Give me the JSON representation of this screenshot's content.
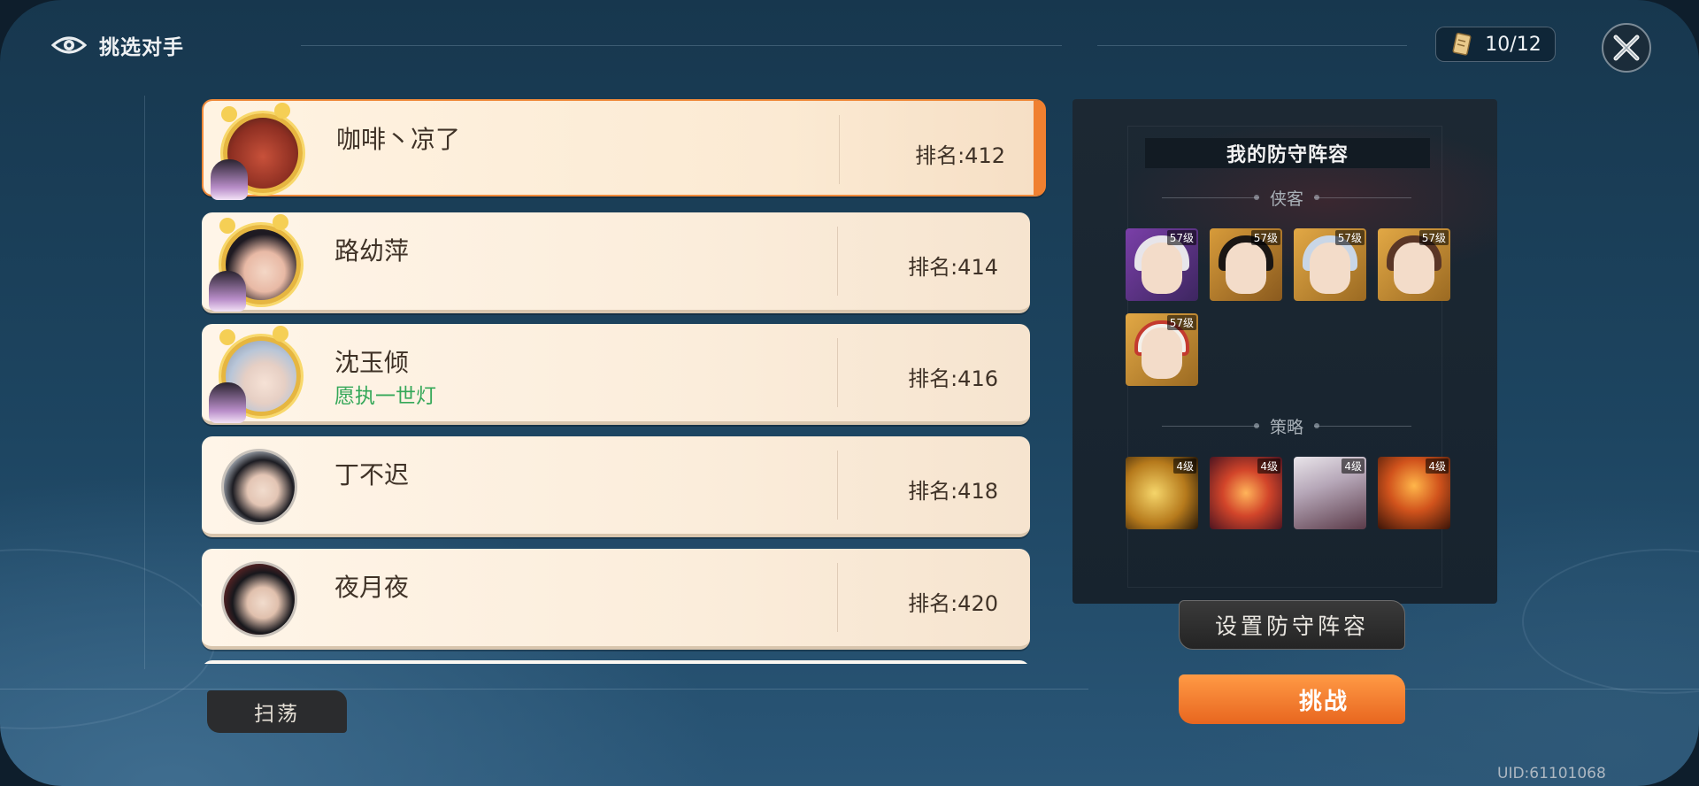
{
  "header": {
    "title": "挑选对手",
    "counter": "10/12"
  },
  "players": [
    {
      "name": "咖啡丶凉了",
      "subtitle": "",
      "rank": "排名:412",
      "selected": true
    },
    {
      "name": "路幼萍",
      "subtitle": "",
      "rank": "排名:414",
      "selected": false
    },
    {
      "name": "沈玉倾",
      "subtitle": "愿执一世灯",
      "rank": "排名:416",
      "selected": false
    },
    {
      "name": "丁不迟",
      "subtitle": "",
      "rank": "排名:418",
      "selected": false
    },
    {
      "name": "夜月夜",
      "subtitle": "",
      "rank": "排名:420",
      "selected": false
    }
  ],
  "defense": {
    "title": "我的防守阵容",
    "heroes_label": "侠客",
    "hero_levels": [
      "57级",
      "57级",
      "57级",
      "57级",
      "57级"
    ],
    "strategy_label": "策略",
    "strategy_levels": [
      "4级",
      "4级",
      "4级",
      "4级"
    ],
    "set_button": "设置防守阵容",
    "challenge_button": "挑战"
  },
  "sweep_button": "扫荡",
  "uid": "UID:61101068",
  "colors": {
    "accent": "#f08a3a",
    "subtitle_green": "#35a859",
    "card_bg": "#fbeddb"
  }
}
